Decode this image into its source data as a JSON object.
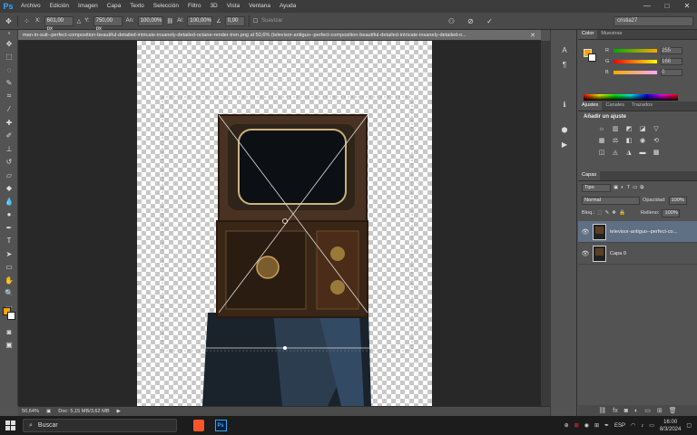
{
  "app": {
    "logo": "Ps"
  },
  "menu": [
    "Archivo",
    "Edición",
    "Imagen",
    "Capa",
    "Texto",
    "Selección",
    "Filtro",
    "3D",
    "Vista",
    "Ventana",
    "Ayuda"
  ],
  "window_controls": {
    "minimize": "—",
    "maximize": "□",
    "close": "✕"
  },
  "options": {
    "x_label": "X:",
    "x_value": "601,00 px",
    "y_label": "Y:",
    "y_value": "750,00 px",
    "w_label": "An:",
    "w_value": "100,00%",
    "h_label": "Al:",
    "h_value": "100,00%",
    "angle_value": "0,00",
    "smooth_label": "Suavizar",
    "workspace": "cristia27"
  },
  "document": {
    "tab_title": "man-in-suit--perfect-composition-beautiful-detailed-intricate-insanely-detailed-octane-render-tren.png al 50,6% (televisor-antiguo--perfect-composition-beautiful-detailed-intricate-insanely-detailed-o...",
    "zoom": "50,64%",
    "doc_info": "Doc: 5,15 MB/3,62 MB"
  },
  "panels": {
    "color_tabs": [
      "Color",
      "Muestras"
    ],
    "color_labels": {
      "r": "R",
      "g": "G",
      "b": "B"
    },
    "color_values": {
      "r": "255",
      "g": "168",
      "b": "0"
    },
    "adj_tabs": [
      "Ajustes",
      "Canales",
      "Trazados"
    ],
    "adj_title": "Añadir un ajuste",
    "layers_tab": "Capas",
    "filter_kind": "Tipo",
    "blend_mode": "Normal",
    "opacity_label": "Opacidad:",
    "opacity_value": "100%",
    "lock_label": "Bloq.:",
    "fill_label": "Relleno:",
    "fill_value": "100%",
    "layers": [
      {
        "name": "televisor-antiguo--perfect-co...",
        "selected": true
      },
      {
        "name": "Capa 0",
        "selected": false
      }
    ]
  },
  "taskbar": {
    "search_placeholder": "Buscar",
    "language": "ESP",
    "time": "16:00",
    "date": "8/3/2024"
  },
  "colors": {
    "foreground": "#f7a500",
    "background": "#ffffff",
    "ps_blue": "#31a8ff"
  }
}
